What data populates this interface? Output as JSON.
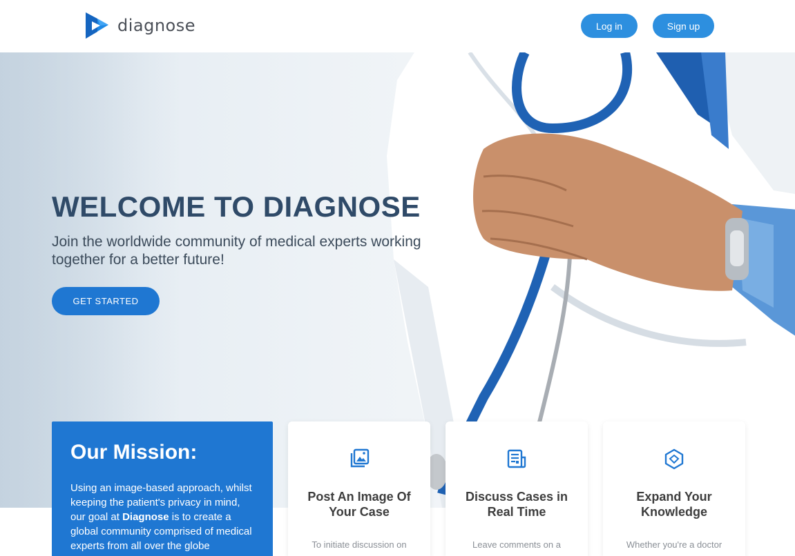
{
  "header": {
    "brand": "diagnose",
    "login_label": "Log in",
    "signup_label": "Sign up"
  },
  "hero": {
    "title": "WELCOME TO DIAGNOSE",
    "subtitle": "Join the worldwide community of medical experts working together for a better future!",
    "cta_label": "GET STARTED"
  },
  "mission": {
    "title": "Our Mission:",
    "text_before": "Using an image-based approach, whilst keeping the patient's privacy in mind, our goal at ",
    "brand": "Diagnose",
    "text_after": " is to create a global community comprised of medical experts from all over the globe"
  },
  "cards": [
    {
      "icon": "image-gallery-icon",
      "title": "Post An Image Of Your Case",
      "text": "To initiate discussion on"
    },
    {
      "icon": "news-article-icon",
      "title": "Discuss Cases in Real Time",
      "text": "Leave comments on a"
    },
    {
      "icon": "hexagon-cube-icon",
      "title": "Expand Your Knowledge",
      "text": "Whether you're a doctor"
    }
  ],
  "colors": {
    "primary": "#1f77d2",
    "button": "#2d8fdf",
    "title": "#2f4a68"
  }
}
